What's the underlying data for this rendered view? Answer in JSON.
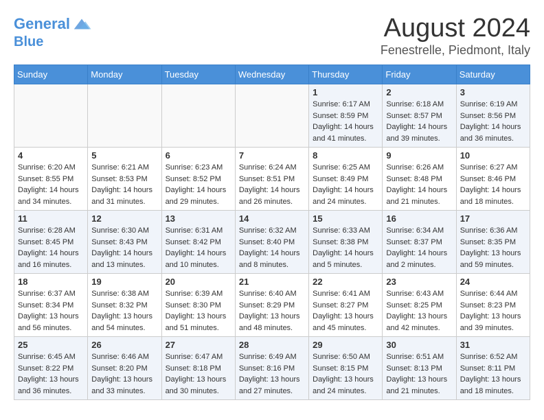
{
  "header": {
    "logo_line1": "General",
    "logo_line2": "Blue",
    "month": "August 2024",
    "location": "Fenestrelle, Piedmont, Italy"
  },
  "weekdays": [
    "Sunday",
    "Monday",
    "Tuesday",
    "Wednesday",
    "Thursday",
    "Friday",
    "Saturday"
  ],
  "weeks": [
    [
      {
        "day": "",
        "info": ""
      },
      {
        "day": "",
        "info": ""
      },
      {
        "day": "",
        "info": ""
      },
      {
        "day": "",
        "info": ""
      },
      {
        "day": "1",
        "info": "Sunrise: 6:17 AM\nSunset: 8:59 PM\nDaylight: 14 hours\nand 41 minutes."
      },
      {
        "day": "2",
        "info": "Sunrise: 6:18 AM\nSunset: 8:57 PM\nDaylight: 14 hours\nand 39 minutes."
      },
      {
        "day": "3",
        "info": "Sunrise: 6:19 AM\nSunset: 8:56 PM\nDaylight: 14 hours\nand 36 minutes."
      }
    ],
    [
      {
        "day": "4",
        "info": "Sunrise: 6:20 AM\nSunset: 8:55 PM\nDaylight: 14 hours\nand 34 minutes."
      },
      {
        "day": "5",
        "info": "Sunrise: 6:21 AM\nSunset: 8:53 PM\nDaylight: 14 hours\nand 31 minutes."
      },
      {
        "day": "6",
        "info": "Sunrise: 6:23 AM\nSunset: 8:52 PM\nDaylight: 14 hours\nand 29 minutes."
      },
      {
        "day": "7",
        "info": "Sunrise: 6:24 AM\nSunset: 8:51 PM\nDaylight: 14 hours\nand 26 minutes."
      },
      {
        "day": "8",
        "info": "Sunrise: 6:25 AM\nSunset: 8:49 PM\nDaylight: 14 hours\nand 24 minutes."
      },
      {
        "day": "9",
        "info": "Sunrise: 6:26 AM\nSunset: 8:48 PM\nDaylight: 14 hours\nand 21 minutes."
      },
      {
        "day": "10",
        "info": "Sunrise: 6:27 AM\nSunset: 8:46 PM\nDaylight: 14 hours\nand 18 minutes."
      }
    ],
    [
      {
        "day": "11",
        "info": "Sunrise: 6:28 AM\nSunset: 8:45 PM\nDaylight: 14 hours\nand 16 minutes."
      },
      {
        "day": "12",
        "info": "Sunrise: 6:30 AM\nSunset: 8:43 PM\nDaylight: 14 hours\nand 13 minutes."
      },
      {
        "day": "13",
        "info": "Sunrise: 6:31 AM\nSunset: 8:42 PM\nDaylight: 14 hours\nand 10 minutes."
      },
      {
        "day": "14",
        "info": "Sunrise: 6:32 AM\nSunset: 8:40 PM\nDaylight: 14 hours\nand 8 minutes."
      },
      {
        "day": "15",
        "info": "Sunrise: 6:33 AM\nSunset: 8:38 PM\nDaylight: 14 hours\nand 5 minutes."
      },
      {
        "day": "16",
        "info": "Sunrise: 6:34 AM\nSunset: 8:37 PM\nDaylight: 14 hours\nand 2 minutes."
      },
      {
        "day": "17",
        "info": "Sunrise: 6:36 AM\nSunset: 8:35 PM\nDaylight: 13 hours\nand 59 minutes."
      }
    ],
    [
      {
        "day": "18",
        "info": "Sunrise: 6:37 AM\nSunset: 8:34 PM\nDaylight: 13 hours\nand 56 minutes."
      },
      {
        "day": "19",
        "info": "Sunrise: 6:38 AM\nSunset: 8:32 PM\nDaylight: 13 hours\nand 54 minutes."
      },
      {
        "day": "20",
        "info": "Sunrise: 6:39 AM\nSunset: 8:30 PM\nDaylight: 13 hours\nand 51 minutes."
      },
      {
        "day": "21",
        "info": "Sunrise: 6:40 AM\nSunset: 8:29 PM\nDaylight: 13 hours\nand 48 minutes."
      },
      {
        "day": "22",
        "info": "Sunrise: 6:41 AM\nSunset: 8:27 PM\nDaylight: 13 hours\nand 45 minutes."
      },
      {
        "day": "23",
        "info": "Sunrise: 6:43 AM\nSunset: 8:25 PM\nDaylight: 13 hours\nand 42 minutes."
      },
      {
        "day": "24",
        "info": "Sunrise: 6:44 AM\nSunset: 8:23 PM\nDaylight: 13 hours\nand 39 minutes."
      }
    ],
    [
      {
        "day": "25",
        "info": "Sunrise: 6:45 AM\nSunset: 8:22 PM\nDaylight: 13 hours\nand 36 minutes."
      },
      {
        "day": "26",
        "info": "Sunrise: 6:46 AM\nSunset: 8:20 PM\nDaylight: 13 hours\nand 33 minutes."
      },
      {
        "day": "27",
        "info": "Sunrise: 6:47 AM\nSunset: 8:18 PM\nDaylight: 13 hours\nand 30 minutes."
      },
      {
        "day": "28",
        "info": "Sunrise: 6:49 AM\nSunset: 8:16 PM\nDaylight: 13 hours\nand 27 minutes."
      },
      {
        "day": "29",
        "info": "Sunrise: 6:50 AM\nSunset: 8:15 PM\nDaylight: 13 hours\nand 24 minutes."
      },
      {
        "day": "30",
        "info": "Sunrise: 6:51 AM\nSunset: 8:13 PM\nDaylight: 13 hours\nand 21 minutes."
      },
      {
        "day": "31",
        "info": "Sunrise: 6:52 AM\nSunset: 8:11 PM\nDaylight: 13 hours\nand 18 minutes."
      }
    ]
  ]
}
